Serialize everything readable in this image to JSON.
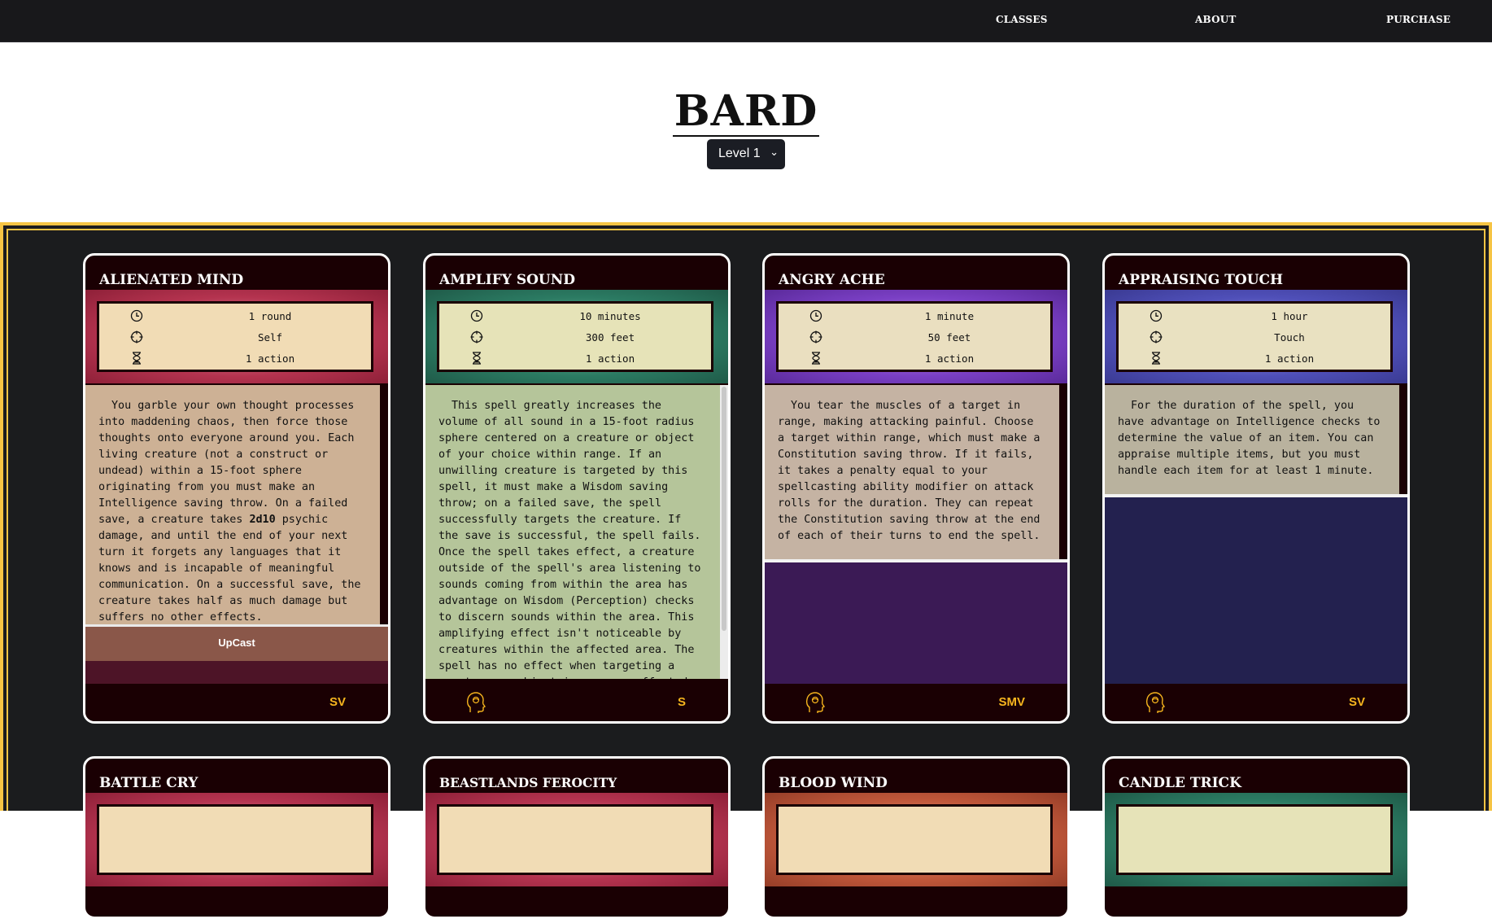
{
  "nav": {
    "classes": "CLASSES",
    "about": "ABOUT",
    "purchase": "PURCHASE"
  },
  "page": {
    "title": "BARD",
    "level_select": "Level 1"
  },
  "cards": [
    {
      "name": "ALIENATED MIND",
      "duration": "1 round",
      "range": "Self",
      "casting_time": "1 action",
      "description_a": "You garble your own thought processes into maddening chaos, then force those thoughts onto everyone around you. Each living creature (not a construct or undead) within a 15-foot sphere originating from you must make an Intelligence saving throw. On a failed save, a creature takes ",
      "description_bold": "2d10",
      "description_b": " psychic damage, and until the end of your next turn it forgets any languages that it knows and is incapable of meaningful communication. On a successful save, the creature takes half as much damage but suffers no other effects.",
      "upcast": "UpCast",
      "components": "SV",
      "concentration": false,
      "band_color": "#b4334f",
      "stats_bg": "#f1dcb5",
      "desc_bg": "#cdb195"
    },
    {
      "name": "AMPLIFY SOUND",
      "duration": "10 minutes",
      "range": "300 feet",
      "casting_time": "1 action",
      "description": "This spell greatly increases the volume of all sound in a 15-foot radius sphere centered on a creature or object of your choice within range. If an unwilling creature is targeted by this spell, it must make a Wisdom saving throw; on a failed save, the spell successfully targets the creature. If the save is successful, the spell fails. Once the spell takes effect, a creature outside of the spell's area listening to sounds coming from within the area has advantage on Wisdom (Perception) checks to discern sounds within the area. This amplifying effect isn't noticeable by creatures within the affected area. The spell has no effect when targeting a creature or object in an area affected by",
      "components": "S",
      "concentration": true,
      "band_color": "#2b7a62",
      "stats_bg": "#e6e3b8",
      "desc_bg": "#b5c59a"
    },
    {
      "name": "ANGRY ACHE",
      "duration": "1 minute",
      "range": "50 feet",
      "casting_time": "1 action",
      "description": "You tear the muscles of a target in range, making attacking painful. Choose a target within range, which must make a Constitution saving throw. If it fails, it takes a penalty equal to your spellcasting ability modifier on attack rolls for the duration. They can repeat the Constitution saving throw at the end of each of their turns to end the spell.",
      "components": "SMV",
      "concentration": true,
      "band_color": "#7a3fc4",
      "stats_bg": "#eadfc0",
      "desc_bg": "#c5b3a3",
      "fill_color": "#3b1a55"
    },
    {
      "name": "APPRAISING TOUCH",
      "duration": "1 hour",
      "range": "Touch",
      "casting_time": "1 action",
      "description": "For the duration of the spell, you have advantage on Intelligence checks to determine the value of an item. You can appraise multiple items, but you must handle each item for at least 1 minute.",
      "components": "SV",
      "concentration": true,
      "band_color": "#4f4fb8",
      "stats_bg": "#e9e1c1",
      "desc_bg": "#b9b29e",
      "fill_color": "#23214f"
    },
    {
      "name": "BATTLE CRY",
      "band_color": "#b4334f",
      "stats_bg": "#f1dcb5"
    },
    {
      "name": "BEASTLANDS FEROCITY",
      "band_color": "#b4334f",
      "stats_bg": "#f1dcb5"
    },
    {
      "name": "BLOOD WIND",
      "band_color": "#c0573a",
      "stats_bg": "#f1dcb5"
    },
    {
      "name": "CANDLE TRICK",
      "band_color": "#2b7a62",
      "stats_bg": "#e6e3b8"
    }
  ]
}
